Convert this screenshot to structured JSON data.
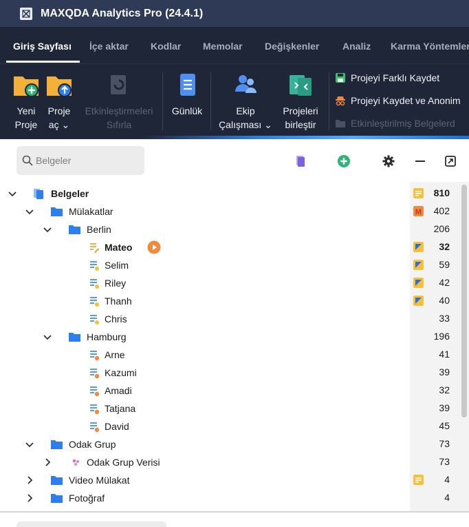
{
  "app": {
    "title": "MAXQDA Analytics Pro (24.4.1)"
  },
  "menu": {
    "tabs": [
      {
        "label": "Giriş Sayfası",
        "active": true
      },
      {
        "label": "İçe aktar"
      },
      {
        "label": "Kodlar"
      },
      {
        "label": "Memolar"
      },
      {
        "label": "Değişkenler"
      },
      {
        "label": "Analiz"
      },
      {
        "label": "Karma Yöntemler"
      }
    ]
  },
  "ribbon": {
    "new_project": {
      "line1": "Yeni",
      "line2": "Proje",
      "icon": "new-project-folder-icon"
    },
    "open_project": {
      "line1": "Proje",
      "line2": "aç ⌄",
      "icon": "open-project-folder-icon"
    },
    "reset_activations": {
      "line1": "Etkinleştirmeleri",
      "line2": "Sıfırla",
      "icon": "reset-activations-icon",
      "disabled": true
    },
    "logbook": {
      "line1": "Günlük",
      "icon": "logbook-icon"
    },
    "teamwork": {
      "line1": "Ekip",
      "line2": "Çalışması ⌄",
      "icon": "teamwork-icon"
    },
    "merge_projects": {
      "line1": "Projeleri",
      "line2": "birleştir",
      "icon": "merge-projects-icon"
    },
    "save_as": {
      "label": "Projeyi Farklı Kaydet",
      "icon": "save-icon"
    },
    "save_anon": {
      "label": "Projeyi Kaydet ve Anonim",
      "icon": "anonymize-icon"
    },
    "activated_docs": {
      "label": "Etkinleştirilmiş Belgelerd",
      "icon": "folder-icon",
      "disabled": true
    }
  },
  "toolbar": {
    "search_placeholder": "Belgeler"
  },
  "tree": {
    "rows": [
      {
        "label": "Belgeler",
        "count": "810",
        "bold": true
      },
      {
        "label": "Mülakatlar",
        "count": "402"
      },
      {
        "label": "Berlin",
        "count": "206"
      },
      {
        "label": "Mateo",
        "count": "32",
        "bold": true
      },
      {
        "label": "Selim",
        "count": "59"
      },
      {
        "label": "Riley",
        "count": "42"
      },
      {
        "label": "Thanh",
        "count": "40"
      },
      {
        "label": "Chris",
        "count": "33"
      },
      {
        "label": "Hamburg",
        "count": "196"
      },
      {
        "label": "Arne",
        "count": "41"
      },
      {
        "label": "Kazumi",
        "count": "39"
      },
      {
        "label": "Amadi",
        "count": "32"
      },
      {
        "label": "Tatjana",
        "count": "39"
      },
      {
        "label": "David",
        "count": "45"
      },
      {
        "label": "Odak Grup",
        "count": "73"
      },
      {
        "label": "Odak Grup Verisi",
        "count": "73"
      },
      {
        "label": "Video Mülakat",
        "count": "4"
      },
      {
        "label": "Fotoğraf",
        "count": "4"
      }
    ]
  },
  "colors": {
    "titlebar": "#2f3a57",
    "ribbon": "#1f2638",
    "folder_blue": "#2d7ff0",
    "memo_yellow": "#f6c03b",
    "accent_orange": "#f08a3c"
  }
}
